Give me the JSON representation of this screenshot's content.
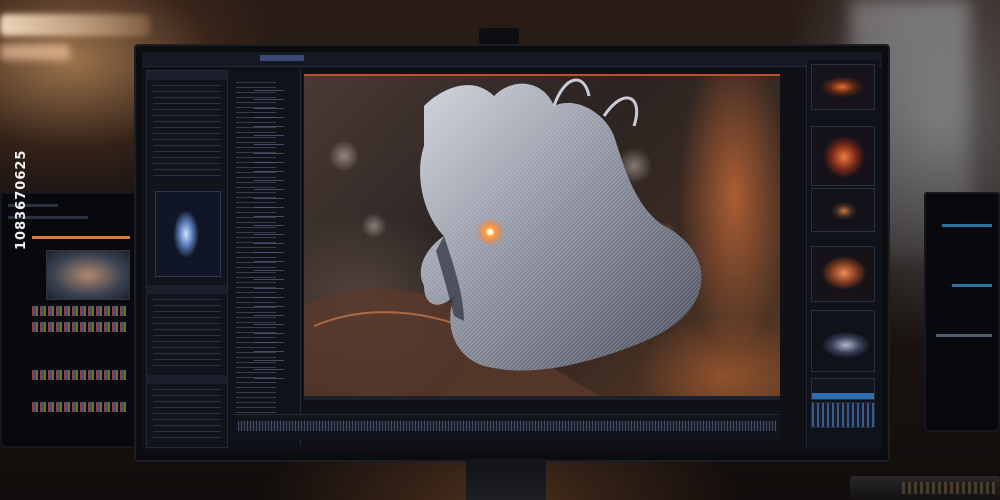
{
  "scene": {
    "description_colors": {
      "accent": "#c0502c",
      "ui_bg": "#0f1116",
      "panel": "#12141b"
    }
  },
  "stock_id": "1083670625"
}
